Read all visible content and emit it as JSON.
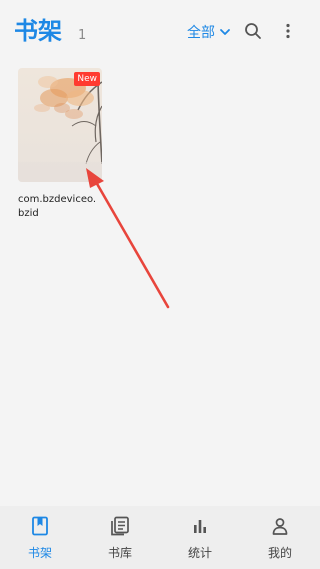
{
  "header": {
    "title": "书架",
    "count": "1",
    "filter_label": "全部"
  },
  "books": [
    {
      "title": "com.bzdeviceo.bzid",
      "badge": "New"
    }
  ],
  "bottom_nav": {
    "items": [
      {
        "label": "书架",
        "icon": "bookmark-icon",
        "active": true
      },
      {
        "label": "书库",
        "icon": "library-icon",
        "active": false
      },
      {
        "label": "统计",
        "icon": "bar-chart-icon",
        "active": false
      },
      {
        "label": "我的",
        "icon": "person-icon",
        "active": false
      }
    ]
  },
  "colors": {
    "accent": "#1e88e5",
    "badge": "#ff3b30",
    "arrow": "#e8453c",
    "background": "#f4f4f4"
  }
}
